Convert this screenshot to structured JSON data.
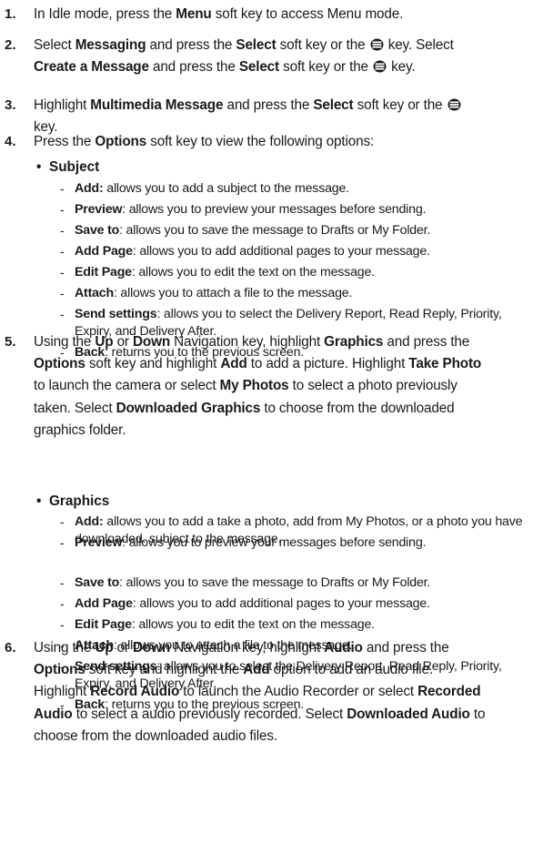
{
  "steps": [
    {
      "num": "1.",
      "lines": [
        [
          {
            "t": "In Idle mode, press the "
          },
          {
            "t": "Menu",
            "b": 1
          },
          {
            "t": " soft key to access Menu mode."
          }
        ]
      ]
    },
    {
      "num": "2.",
      "lines": [
        [
          {
            "t": "Select "
          },
          {
            "t": "Messaging",
            "b": 1
          },
          {
            "t": " and press the "
          },
          {
            "t": "Select",
            "b": 1
          },
          {
            "t": " soft key or the "
          },
          {
            "icon": 1
          },
          {
            "t": " key. Select"
          }
        ],
        [
          {
            "t": "Create a Message",
            "b": 1
          },
          {
            "t": " and press the "
          },
          {
            "t": "Select",
            "b": 1
          },
          {
            "t": " soft key or the "
          },
          {
            "icon": 1
          },
          {
            "t": " key."
          }
        ]
      ]
    },
    {
      "num": "3.",
      "lines": [
        [
          {
            "t": "Highlight "
          },
          {
            "t": "Multimedia Message",
            "b": 1
          },
          {
            "t": " and press the "
          },
          {
            "t": "Select",
            "b": 1
          },
          {
            "t": " soft key or the "
          },
          {
            "icon": 1
          }
        ],
        [
          {
            "t": "key."
          }
        ]
      ]
    },
    {
      "num": "4.",
      "lines": [
        [
          {
            "t": "Press the "
          },
          {
            "t": "Options",
            "b": 1
          },
          {
            "t": " soft key to view the following options:"
          }
        ]
      ]
    },
    {
      "num": "5.",
      "lines": [
        [
          {
            "t": "Using the "
          },
          {
            "t": "Up",
            "b": 1
          },
          {
            "t": " or "
          },
          {
            "t": "Down",
            "b": 1
          },
          {
            "t": " Navigation key, highlight "
          },
          {
            "t": "Graphics",
            "b": 1
          },
          {
            "t": " and press the"
          }
        ],
        [
          {
            "t": "Options",
            "b": 1
          },
          {
            "t": " soft key and highlight "
          },
          {
            "t": "Add",
            "b": 1
          },
          {
            "t": " to add a picture. Highlight "
          },
          {
            "t": "Take Photo",
            "b": 1
          }
        ],
        [
          {
            "t": "to launch the camera or select "
          },
          {
            "t": "My Photos",
            "b": 1
          },
          {
            "t": " to select a photo previously"
          }
        ],
        [
          {
            "t": "taken. Select "
          },
          {
            "t": "Downloaded Graphics",
            "b": 1
          },
          {
            "t": " to choose from the downloaded"
          }
        ],
        [
          {
            "t": "graphics folder."
          }
        ]
      ]
    },
    {
      "num": "6.",
      "lines": [
        [
          {
            "t": "Using the "
          },
          {
            "t": "Up",
            "b": 1
          },
          {
            "t": " or "
          },
          {
            "t": "Down",
            "b": 1
          },
          {
            "t": " Navigation key, highlight "
          },
          {
            "t": "Audio",
            "b": 1
          },
          {
            "t": " and press the"
          }
        ],
        [
          {
            "t": "Options",
            "b": 1
          },
          {
            "t": " soft key and highlight the "
          },
          {
            "t": "Add",
            "b": 1
          },
          {
            "t": " option to add an audio file."
          }
        ],
        [
          {
            "t": "Highlight "
          },
          {
            "t": "Record Audio",
            "b": 1
          },
          {
            "t": " to launch the Audio Recorder or select "
          },
          {
            "t": "Recorded",
            "b": 1
          }
        ],
        [
          {
            "t": "Audio",
            "b": 1
          },
          {
            "t": " to select a audio previously recorded. Select "
          },
          {
            "t": "Downloaded Audio",
            "b": 1
          },
          {
            "t": " to"
          }
        ],
        [
          {
            "t": "choose from the downloaded audio files."
          }
        ]
      ]
    }
  ],
  "bullets": [
    {
      "label": "Subject"
    },
    {
      "label": "Graphics"
    }
  ],
  "options_subject": [
    [
      [
        {
          "t": "Add:",
          "b": 1
        },
        {
          "t": " allows you to add a subject to the message."
        }
      ]
    ],
    [
      [
        {
          "t": "Preview",
          "b": 1
        },
        {
          "t": ": allows you to preview your messages before sending."
        }
      ]
    ],
    [
      [
        {
          "t": "Save to",
          "b": 1
        },
        {
          "t": ": allows you to save the message to Drafts or My Folder."
        }
      ]
    ],
    [
      [
        {
          "t": "Add Page",
          "b": 1
        },
        {
          "t": ": allows you to add additional pages to your message."
        }
      ]
    ],
    [
      [
        {
          "t": "Edit Page",
          "b": 1
        },
        {
          "t": ": allows you to edit the text on the message."
        }
      ]
    ],
    [
      [
        {
          "t": "Attach",
          "b": 1
        },
        {
          "t": ": allows you to attach a file to the message."
        }
      ]
    ],
    [
      [
        {
          "t": "Send settings",
          "b": 1
        },
        {
          "t": ": allows you to select the Delivery Report, Read Reply, Priority,"
        }
      ],
      [
        {
          "t": "Expiry, and Delivery After."
        }
      ]
    ],
    [
      [
        {
          "t": "Back",
          "b": 1
        },
        {
          "t": ": returns you to the previous screen."
        }
      ]
    ]
  ],
  "options_graphics": [
    [
      [
        {
          "t": "Add:",
          "b": 1
        },
        {
          "t": " allows you to add a take a photo, add from My Photos, or a photo you have"
        }
      ],
      [
        {
          "t": "downloaded. subject to the message."
        }
      ]
    ],
    [
      [
        {
          "t": "Preview",
          "b": 1
        },
        {
          "t": ": allows you to preview your messages before sending."
        }
      ]
    ],
    [
      [
        {
          "t": "Save to",
          "b": 1
        },
        {
          "t": ": allows you to save the message to Drafts or My Folder."
        }
      ]
    ],
    [
      [
        {
          "t": "Add Page",
          "b": 1
        },
        {
          "t": ": allows you to add additional pages to your message."
        }
      ]
    ],
    [
      [
        {
          "t": "Edit Page",
          "b": 1
        },
        {
          "t": ": allows you to edit the text on the message."
        }
      ]
    ],
    [
      [
        {
          "t": "Attach",
          "b": 1
        },
        {
          "t": ": allows you to attach a file to the message."
        }
      ]
    ],
    [
      [
        {
          "t": "Send settings",
          "b": 1
        },
        {
          "t": ": allows you to select the Delivery Report, Read Reply, Priority,"
        }
      ],
      [
        {
          "t": "Expiry, and Delivery After."
        }
      ]
    ],
    [
      [
        {
          "t": "Back",
          "b": 1
        },
        {
          "t": ": returns you to the previous screen."
        }
      ]
    ]
  ],
  "icons": {
    "center_key": "ok-key-icon"
  },
  "colors": {
    "text": "#1a1a1a"
  }
}
